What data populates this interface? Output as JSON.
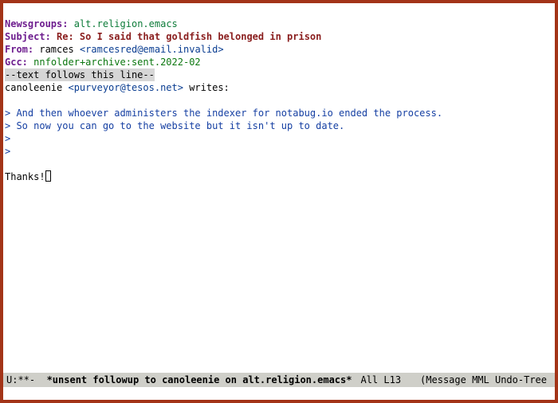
{
  "headers": {
    "newsgroups_key": "Newsgroups:",
    "newsgroups_val": "alt.religion.emacs",
    "subject_key": "Subject:",
    "subject_val": "Re: So I said that goldfish belonged in prison",
    "from_key": "From:",
    "from_name": "ramces",
    "from_addr": "<ramcesred@email.invalid>",
    "gcc_key": "Gcc:",
    "gcc_val": "nnfolder+archive:sent.2022-02",
    "separator": "--text follows this line--"
  },
  "body": {
    "cite_name": "canoleenie",
    "cite_addr": "<purveyor@tesos.net>",
    "cite_suffix": " writes:",
    "quote1": "> And then whoever administers the indexer for notabug.io ended the process.",
    "quote2": "> So now you can go to the website but it isn't up to date.",
    "quote3": ">",
    "quote4": ">",
    "reply": "Thanks!"
  },
  "modeline": {
    "left": "U:**-  ",
    "buffer_name": "*unsent followup to canoleenie on alt.religion.emacs*",
    "position": "All L13",
    "modes": "(Message MML Undo-Tree"
  }
}
